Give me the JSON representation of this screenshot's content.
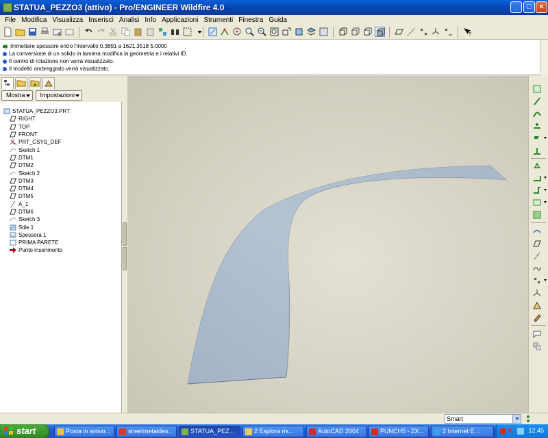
{
  "window": {
    "title": "STATUA_PEZZO3 (attivo) - Pro/ENGINEER Wildfire 4.0",
    "buttons": {
      "minimize": "_",
      "maximize": "□",
      "close": "×"
    }
  },
  "menu": [
    "File",
    "Modifica",
    "Visualizza",
    "Inserisci",
    "Analisi",
    "Info",
    "Applicazioni",
    "Strumenti",
    "Finestra",
    "Guida"
  ],
  "messages": [
    {
      "kind": "ok",
      "text": "Immettere spessore entro l'intervallo 0.3891 a 1621.3518   5.0000"
    },
    {
      "kind": "info",
      "text": "La conversione di un solido in lamiera modifica la geometria e i relativi ID."
    },
    {
      "kind": "info",
      "text": "Il centro di rotazione non verrà visualizzato."
    },
    {
      "kind": "info",
      "text": "Il modello ombreggiato verrà visualizzato."
    }
  ],
  "panel": {
    "show_button": "Mostra",
    "settings_button": "Impostazioni"
  },
  "tree": {
    "root": "STATUA_PEZZO3.PRT",
    "items": [
      {
        "label": "RIGHT",
        "icon": "datum-plane-icon"
      },
      {
        "label": "TOP",
        "icon": "datum-plane-icon"
      },
      {
        "label": "FRONT",
        "icon": "datum-plane-icon"
      },
      {
        "label": "PRT_CSYS_DEF",
        "icon": "csys-icon"
      },
      {
        "label": "Sketch 1",
        "icon": "sketch-icon"
      },
      {
        "label": "DTM1",
        "icon": "datum-plane-icon"
      },
      {
        "label": "DTM2",
        "icon": "datum-plane-icon"
      },
      {
        "label": "Sketch 2",
        "icon": "sketch-icon"
      },
      {
        "label": "DTM3",
        "icon": "datum-plane-icon"
      },
      {
        "label": "DTM4",
        "icon": "datum-plane-icon"
      },
      {
        "label": "DTM5",
        "icon": "datum-plane-icon"
      },
      {
        "label": "A_1",
        "icon": "axis-icon"
      },
      {
        "label": "DTM6",
        "icon": "datum-plane-icon"
      },
      {
        "label": "Sketch 3",
        "icon": "sketch-icon"
      },
      {
        "label": "Stile 1",
        "icon": "style-icon"
      },
      {
        "label": "Spessora 1",
        "icon": "thicken-icon"
      },
      {
        "label": "PRIMA PARETE",
        "icon": "wall-icon"
      },
      {
        "label": "Punto inserimento",
        "icon": "insert-arrow-icon"
      }
    ]
  },
  "status": {
    "filter": "Smart"
  },
  "taskbar": {
    "start": "start",
    "tasks": [
      {
        "label": "Posta in arrivo...",
        "color": "#f0c040"
      },
      {
        "label": "sheetmetaldes...",
        "color": "#d83a2a"
      },
      {
        "label": "STATUA_PEZ...",
        "color": "#7fb04a"
      },
      {
        "label": "2 Esplora ris...",
        "color": "#f3cc55"
      },
      {
        "label": "AutoCAD 2004",
        "color": "#c8302a"
      },
      {
        "label": "PUNCH5 - ZX...",
        "color": "#c8302a"
      },
      {
        "label": "2 Internet E...",
        "color": "#3aa0ee"
      }
    ],
    "clock": "12.45"
  },
  "colors": {
    "titlebar": "#0842b0",
    "viewport_bg": "#d3d0c2",
    "surface": "#a9b9c9"
  }
}
